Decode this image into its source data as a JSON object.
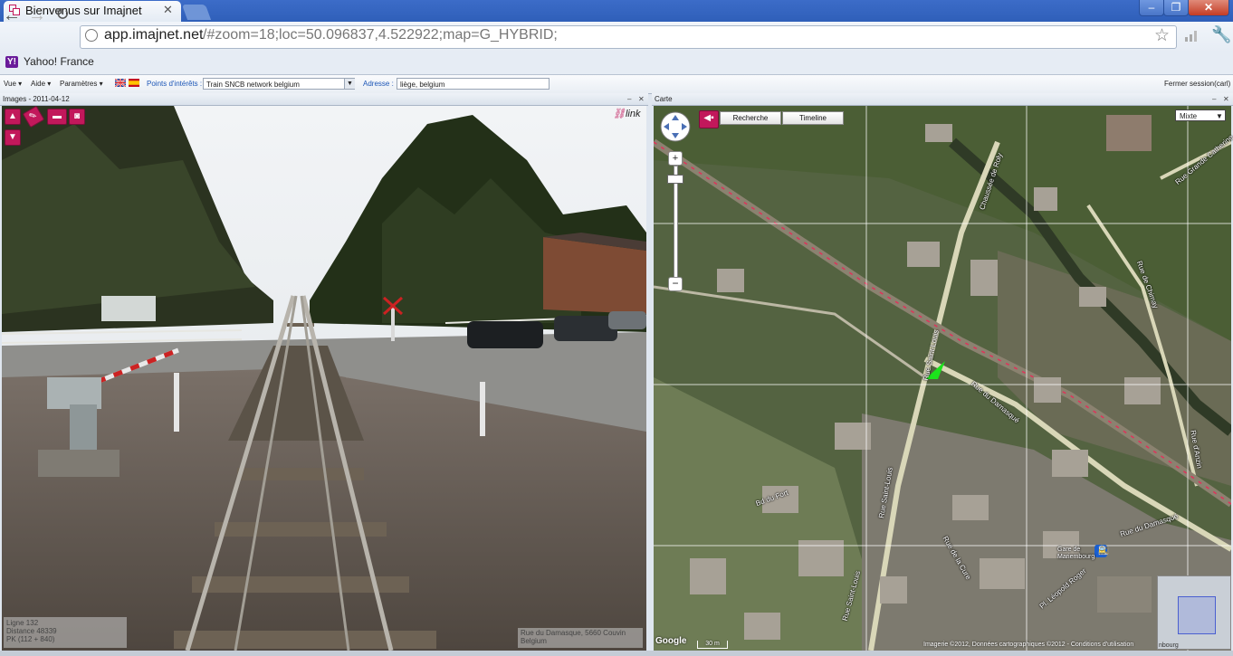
{
  "browser": {
    "tab_title": "Bienvenus sur Imajnet",
    "url_host": "app.imajnet.net",
    "url_rest": "/#zoom=18;loc=50.096837,4.522922;map=G_HYBRID;",
    "bookmark": "Yahoo! France"
  },
  "menu": {
    "vue": "Vue",
    "aide": "Aide",
    "parametres": "Paramètres",
    "poi_label": "Points d'intérêts :",
    "poi_value": "Train SNCB network belgium",
    "addr_label": "Adresse :",
    "addr_value": "liège, belgium",
    "logout": "Fermer session(carl)"
  },
  "images_panel": {
    "title": "Images - 2011-04-12",
    "link_label": "link",
    "info_left": [
      "Ligne 132",
      "Distance 48339",
      "PK (112 + 840)"
    ],
    "info_right": [
      "Rue du Damasque, 5660 Couvin",
      "Belgium"
    ]
  },
  "map_panel": {
    "title": "Carte",
    "search_button": "Recherche",
    "timeline_button": "Timeline",
    "map_type": "Mixte",
    "scale": "30 m",
    "copyright": "Imagerie ©2012, Données cartographiques ©2012 - Conditions d'utilisation",
    "station_label": "Gare de Mariembourg",
    "streets": [
      "Chaussée de Roly",
      "Rue Saint-Louis",
      "Rue du Damasqué",
      "Rue du Damasqué",
      "Rue Saint-Louis",
      "Bd du Fort",
      "Rue de la Cure",
      "Pl. Léopold Roger",
      "Rue Saint-Louis",
      "Rue de Chimay",
      "Rue d'Anzin",
      "Rue Grande Catherine"
    ],
    "minimap_label": "nbourg"
  },
  "colors": {
    "tool_accent": "#c2185b",
    "link_text": "#1c56b6",
    "position_marker": "#1ce31c"
  }
}
